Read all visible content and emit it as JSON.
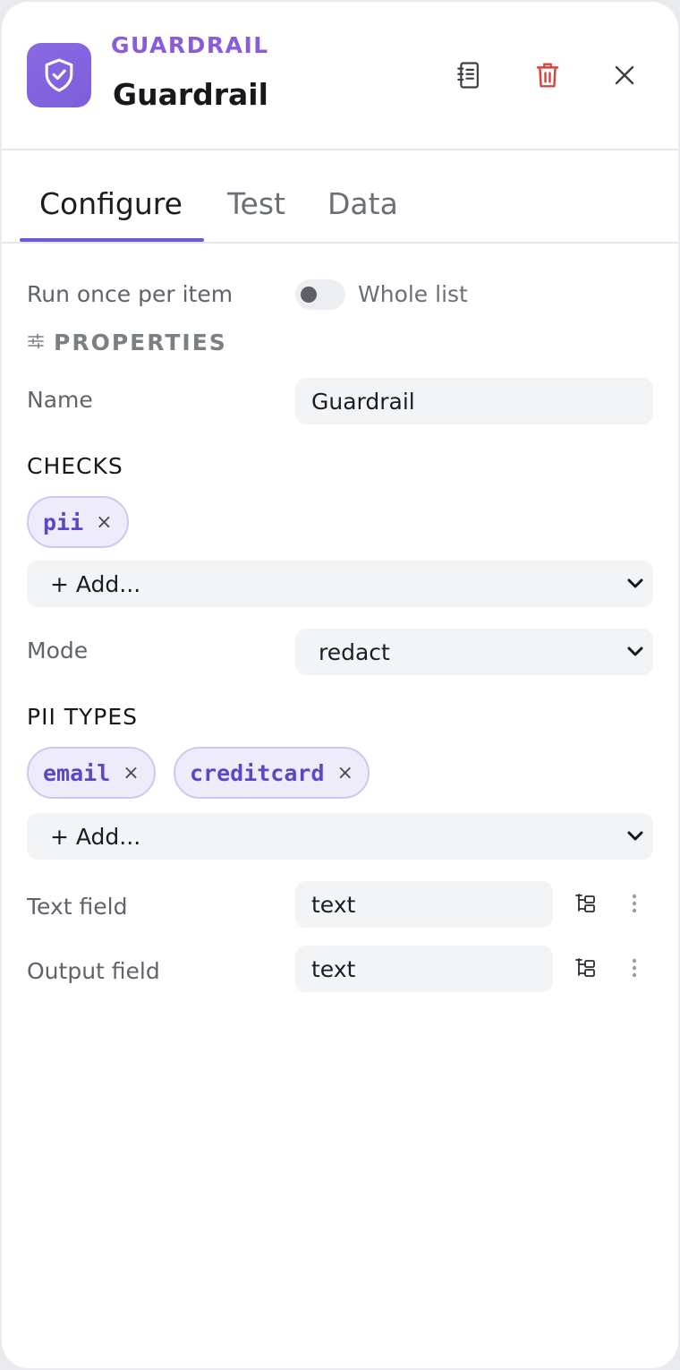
{
  "header": {
    "kind": "GUARDRAIL",
    "title": "Guardrail",
    "icons": {
      "node": "shield-check-icon",
      "docs": "notebook-icon",
      "delete": "trash-icon",
      "close": "close-icon"
    },
    "colors": {
      "accent": "#8a5cdb",
      "delete": "#d6453d"
    }
  },
  "tabs": [
    {
      "label": "Configure",
      "active": true
    },
    {
      "label": "Test",
      "active": false
    },
    {
      "label": "Data",
      "active": false
    }
  ],
  "config": {
    "run_label": "Run once per item",
    "toggle_label": "Whole list",
    "toggle_on": false,
    "properties_heading": "PROPERTIES",
    "name_label": "Name",
    "name_value": "Guardrail",
    "checks_heading": "CHECKS",
    "checks": [
      "pii"
    ],
    "checks_add": "+ Add...",
    "mode_label": "Mode",
    "mode_value": "redact",
    "pii_heading": "PII TYPES",
    "pii_types": [
      "email",
      "creditcard"
    ],
    "pii_add": "+ Add...",
    "text_field_label": "Text field",
    "text_field_value": "text",
    "output_field_label": "Output field",
    "output_field_value": "text",
    "chip_remove": "×"
  }
}
